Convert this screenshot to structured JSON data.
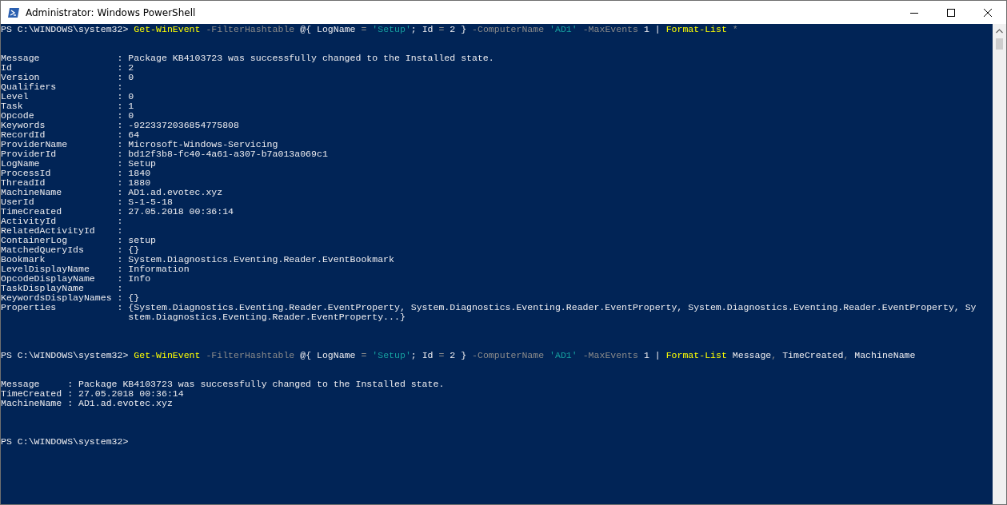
{
  "window": {
    "title": "Administrator: Windows PowerShell"
  },
  "console": [
    {
      "kind": "command",
      "tokens": [
        {
          "kind": "prompt",
          "text": "PS C:\\WINDOWS\\system32> "
        },
        {
          "kind": "cmdlet",
          "text": "Get-WinEvent"
        },
        {
          "kind": "parameter",
          "text": " -FilterHashtable"
        },
        {
          "kind": "plain",
          "text": " @{ LogName "
        },
        {
          "kind": "operator",
          "text": "="
        },
        {
          "kind": "string",
          "text": " 'Setup'"
        },
        {
          "kind": "plain",
          "text": "; Id "
        },
        {
          "kind": "operator",
          "text": "="
        },
        {
          "kind": "plain",
          "text": " 2 } "
        },
        {
          "kind": "parameter",
          "text": "-ComputerName"
        },
        {
          "kind": "string",
          "text": " 'AD1'"
        },
        {
          "kind": "parameter",
          "text": " -MaxEvents"
        },
        {
          "kind": "plain",
          "text": " 1 | "
        },
        {
          "kind": "cmdlet",
          "text": "Format-List"
        },
        {
          "kind": "operator",
          "text": " *"
        }
      ]
    },
    {
      "kind": "blank"
    },
    {
      "kind": "blank"
    },
    {
      "kind": "output",
      "text": "Message              : Package KB4103723 was successfully changed to the Installed state."
    },
    {
      "kind": "output",
      "text": "Id                   : 2"
    },
    {
      "kind": "output",
      "text": "Version              : 0"
    },
    {
      "kind": "output",
      "text": "Qualifiers           :"
    },
    {
      "kind": "output",
      "text": "Level                : 0"
    },
    {
      "kind": "output",
      "text": "Task                 : 1"
    },
    {
      "kind": "output",
      "text": "Opcode               : 0"
    },
    {
      "kind": "output",
      "text": "Keywords             : -9223372036854775808"
    },
    {
      "kind": "output",
      "text": "RecordId             : 64"
    },
    {
      "kind": "output",
      "text": "ProviderName         : Microsoft-Windows-Servicing"
    },
    {
      "kind": "output",
      "text": "ProviderId           : bd12f3b8-fc40-4a61-a307-b7a013a069c1"
    },
    {
      "kind": "output",
      "text": "LogName              : Setup"
    },
    {
      "kind": "output",
      "text": "ProcessId            : 1840"
    },
    {
      "kind": "output",
      "text": "ThreadId             : 1880"
    },
    {
      "kind": "output",
      "text": "MachineName          : AD1.ad.evotec.xyz"
    },
    {
      "kind": "output",
      "text": "UserId               : S-1-5-18"
    },
    {
      "kind": "output",
      "text": "TimeCreated          : 27.05.2018 00:36:14"
    },
    {
      "kind": "output",
      "text": "ActivityId           :"
    },
    {
      "kind": "output",
      "text": "RelatedActivityId    :"
    },
    {
      "kind": "output",
      "text": "ContainerLog         : setup"
    },
    {
      "kind": "output",
      "text": "MatchedQueryIds      : {}"
    },
    {
      "kind": "output",
      "text": "Bookmark             : System.Diagnostics.Eventing.Reader.EventBookmark"
    },
    {
      "kind": "output",
      "text": "LevelDisplayName     : Information"
    },
    {
      "kind": "output",
      "text": "OpcodeDisplayName    : Info"
    },
    {
      "kind": "output",
      "text": "TaskDisplayName      :"
    },
    {
      "kind": "output",
      "text": "KeywordsDisplayNames : {}"
    },
    {
      "kind": "output",
      "text": "Properties           : {System.Diagnostics.Eventing.Reader.EventProperty, System.Diagnostics.Eventing.Reader.EventProperty, System.Diagnostics.Eventing.Reader.EventProperty, Sy"
    },
    {
      "kind": "output",
      "text": "                       stem.Diagnostics.Eventing.Reader.EventProperty...}"
    },
    {
      "kind": "blank"
    },
    {
      "kind": "blank"
    },
    {
      "kind": "blank"
    },
    {
      "kind": "command",
      "tokens": [
        {
          "kind": "prompt",
          "text": "PS C:\\WINDOWS\\system32> "
        },
        {
          "kind": "cmdlet",
          "text": "Get-WinEvent"
        },
        {
          "kind": "parameter",
          "text": " -FilterHashtable"
        },
        {
          "kind": "plain",
          "text": " @{ LogName "
        },
        {
          "kind": "operator",
          "text": "="
        },
        {
          "kind": "string",
          "text": " 'Setup'"
        },
        {
          "kind": "plain",
          "text": "; Id "
        },
        {
          "kind": "operator",
          "text": "="
        },
        {
          "kind": "plain",
          "text": " 2 } "
        },
        {
          "kind": "parameter",
          "text": "-ComputerName"
        },
        {
          "kind": "string",
          "text": " 'AD1'"
        },
        {
          "kind": "parameter",
          "text": " -MaxEvents"
        },
        {
          "kind": "plain",
          "text": " 1 | "
        },
        {
          "kind": "cmdlet",
          "text": "Format-List"
        },
        {
          "kind": "plain",
          "text": " Message"
        },
        {
          "kind": "operator",
          "text": ","
        },
        {
          "kind": "plain",
          "text": " TimeCreated"
        },
        {
          "kind": "operator",
          "text": ","
        },
        {
          "kind": "plain",
          "text": " MachineName"
        }
      ]
    },
    {
      "kind": "blank"
    },
    {
      "kind": "blank"
    },
    {
      "kind": "output",
      "text": "Message     : Package KB4103723 was successfully changed to the Installed state."
    },
    {
      "kind": "output",
      "text": "TimeCreated : 27.05.2018 00:36:14"
    },
    {
      "kind": "output",
      "text": "MachineName : AD1.ad.evotec.xyz"
    },
    {
      "kind": "blank"
    },
    {
      "kind": "blank"
    },
    {
      "kind": "blank"
    },
    {
      "kind": "command",
      "tokens": [
        {
          "kind": "prompt",
          "text": "PS C:\\WINDOWS\\system32>"
        }
      ]
    }
  ]
}
